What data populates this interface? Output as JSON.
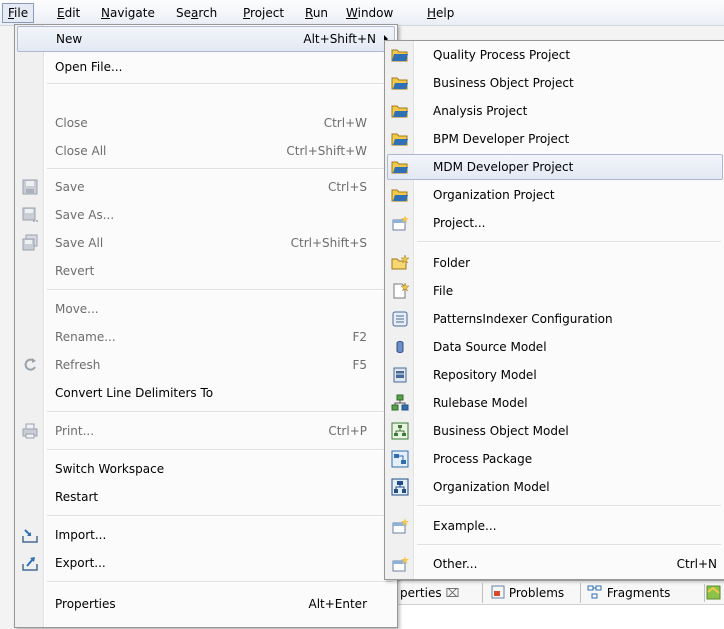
{
  "menubar": {
    "items": [
      {
        "label": "File",
        "ul": "F",
        "rest": "ile",
        "active": true
      },
      {
        "label": "Edit",
        "ul": "E",
        "rest": "dit"
      },
      {
        "label": "Navigate",
        "ul": "N",
        "rest": "avigate"
      },
      {
        "label": "Search",
        "pre": "Se",
        "ul": "a",
        "rest": "rch"
      },
      {
        "label": "Project",
        "ul": "P",
        "rest": "roject"
      },
      {
        "label": "Run",
        "ul": "R",
        "rest": "un"
      },
      {
        "label": "Window",
        "ul": "W",
        "rest": "indow"
      },
      {
        "label": "Help",
        "ul": "H",
        "rest": "elp"
      }
    ]
  },
  "file_menu": {
    "items": [
      {
        "label": "New",
        "shortcut": "Alt+Shift+N",
        "submenu": true,
        "highlighted": true
      },
      {
        "label": "Open File..."
      },
      {
        "label": "Close",
        "shortcut": "Ctrl+W",
        "disabled": true
      },
      {
        "label": "Close All",
        "shortcut": "Ctrl+Shift+W",
        "disabled": true
      },
      {
        "label": "Save",
        "shortcut": "Ctrl+S",
        "disabled": true,
        "icon": "save-icon"
      },
      {
        "label": "Save As...",
        "disabled": true,
        "icon": "save-as-icon"
      },
      {
        "label": "Save All",
        "shortcut": "Ctrl+Shift+S",
        "disabled": true,
        "icon": "save-all-icon"
      },
      {
        "label": "Revert",
        "disabled": true
      },
      {
        "label": "Move...",
        "disabled": true
      },
      {
        "label": "Rename...",
        "shortcut": "F2",
        "disabled": true
      },
      {
        "label": "Refresh",
        "shortcut": "F5",
        "disabled": true,
        "icon": "refresh-icon"
      },
      {
        "label": "Convert Line Delimiters To",
        "submenu": true
      },
      {
        "label": "Print...",
        "shortcut": "Ctrl+P",
        "disabled": true,
        "icon": "print-icon"
      },
      {
        "label": "Switch Workspace",
        "submenu": true
      },
      {
        "label": "Restart"
      },
      {
        "label": "Import...",
        "icon": "import-icon"
      },
      {
        "label": "Export...",
        "icon": "export-icon"
      },
      {
        "label": "Properties",
        "shortcut": "Alt+Enter"
      }
    ]
  },
  "new_submenu": {
    "items": [
      {
        "label": "Quality Process Project",
        "icon": "project-folder-icon"
      },
      {
        "label": "Business Object Project",
        "icon": "project-folder-icon"
      },
      {
        "label": "Analysis Project",
        "icon": "project-folder-icon"
      },
      {
        "label": "BPM Developer Project",
        "icon": "project-folder-icon"
      },
      {
        "label": "MDM Developer Project",
        "icon": "project-folder-icon",
        "highlighted": true
      },
      {
        "label": "Organization Project",
        "icon": "project-folder-icon"
      },
      {
        "label": "Project...",
        "icon": "new-project-icon"
      },
      {
        "label": "Folder",
        "icon": "new-folder-icon"
      },
      {
        "label": "File",
        "icon": "new-file-icon"
      },
      {
        "label": "PatternsIndexer Configuration",
        "icon": "configuration-icon"
      },
      {
        "label": "Data Source Model",
        "icon": "data-source-icon"
      },
      {
        "label": "Repository Model",
        "icon": "repository-icon"
      },
      {
        "label": "Rulebase Model",
        "icon": "rulebase-icon"
      },
      {
        "label": "Business Object Model",
        "icon": "business-object-model-icon"
      },
      {
        "label": "Process Package",
        "icon": "process-package-icon"
      },
      {
        "label": "Organization Model",
        "icon": "organization-model-icon"
      },
      {
        "label": "Example...",
        "icon": "example-icon"
      },
      {
        "label": "Other...",
        "shortcut": "Ctrl+N",
        "icon": "other-wizard-icon"
      }
    ]
  },
  "view_tabs": {
    "properties": "perties",
    "problems": "Problems",
    "fragments": "Fragments"
  },
  "colors": {
    "highlight_border": "#aeb9cf",
    "disabled_text": "#6d6d6d",
    "folder_yellow": "#f2c94c",
    "folder_blue": "#2f6fb3"
  }
}
